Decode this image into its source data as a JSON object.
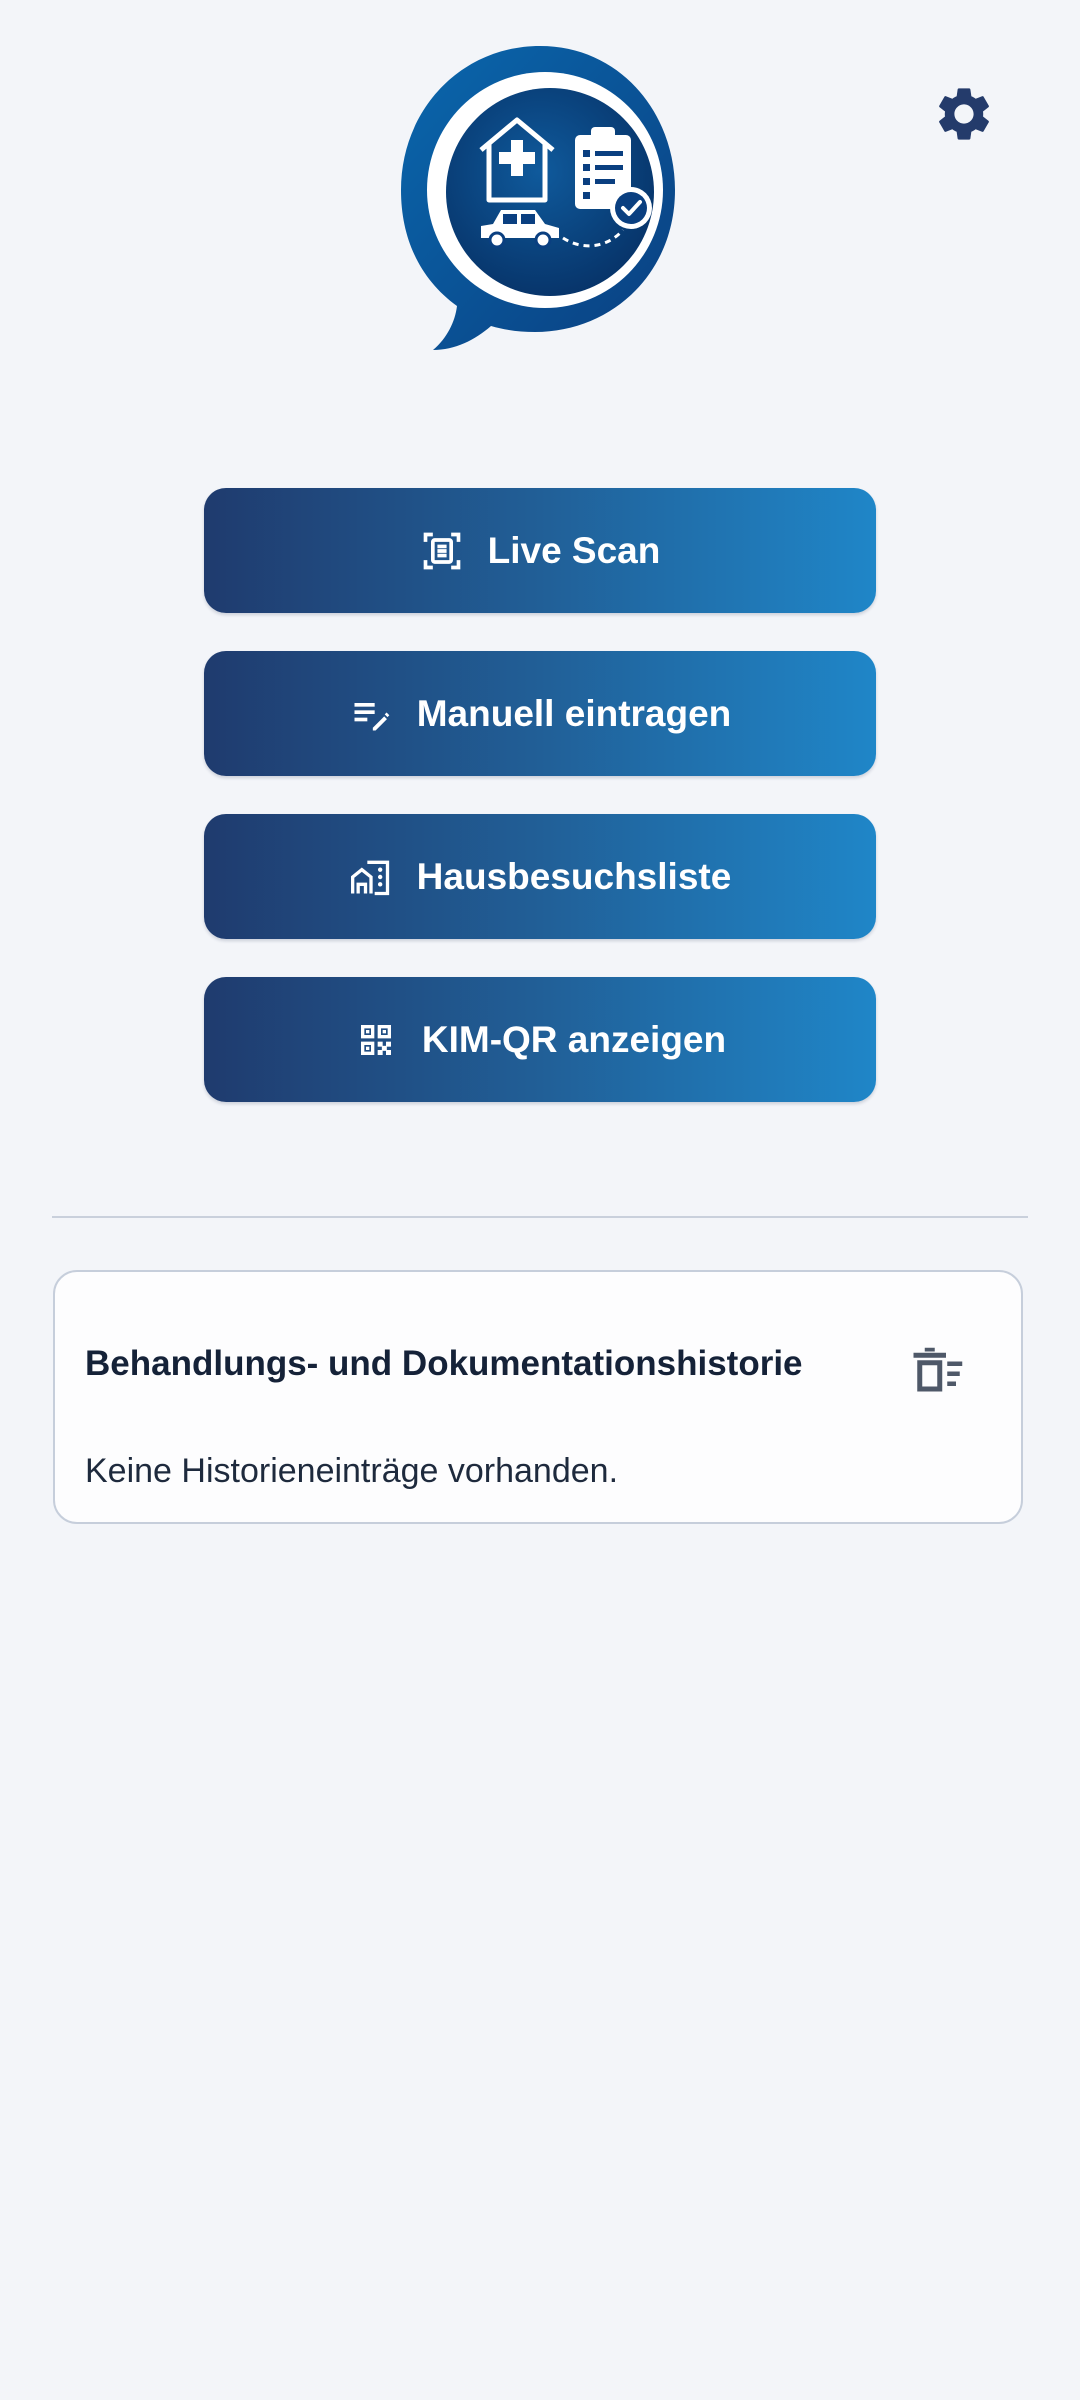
{
  "header": {
    "logo_icon": "medical-home-visit-logo-icon",
    "settings_icon": "gear-icon"
  },
  "actions": [
    {
      "label": "Live Scan",
      "icon": "document-scan-icon"
    },
    {
      "label": "Manuell eintragen",
      "icon": "edit-list-icon"
    },
    {
      "label": "Hausbesuchsliste",
      "icon": "home-work-icon"
    },
    {
      "label": "KIM-QR anzeigen",
      "icon": "qr-code-icon"
    }
  ],
  "history": {
    "title": "Behandlungs- und Dokumentationshistorie",
    "empty_text": "Keine Historieneinträge vorhanden.",
    "delete_icon": "delete-history-icon"
  },
  "colors": {
    "background": "#f3f5f9",
    "button_gradient_start": "#1f3b6e",
    "button_gradient_end": "#1f86c8",
    "settings_icon": "#243b6b",
    "card_border": "#c6cedb",
    "delete_icon": "#4e5868"
  }
}
